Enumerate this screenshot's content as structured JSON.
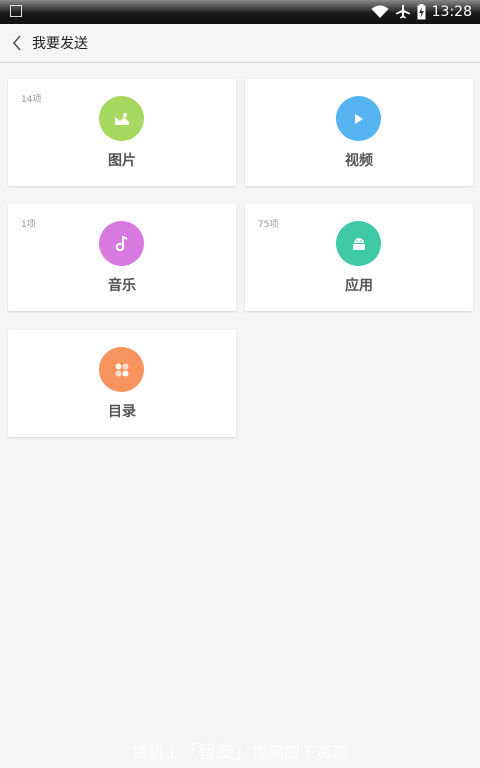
{
  "status": {
    "time": "13:28"
  },
  "header": {
    "title": "我要发送"
  },
  "cards": [
    {
      "count": "14项",
      "label": "图片",
      "icon": "image-icon",
      "color": "#a7d85f"
    },
    {
      "count": "",
      "label": "视频",
      "icon": "play-icon",
      "color": "#55b4f0"
    },
    {
      "count": "1项",
      "label": "音乐",
      "icon": "music-note-icon",
      "color": "#d97ae0"
    },
    {
      "count": "75项",
      "label": "应用",
      "icon": "android-icon",
      "color": "#3fc9a6"
    },
    {
      "count": "",
      "label": "目录",
      "icon": "folder-grid-icon",
      "color": "#f7935e"
    }
  ],
  "watermark": {
    "pre": "搞机上",
    "brand": "「智友」",
    "post": "提问题下资源"
  }
}
